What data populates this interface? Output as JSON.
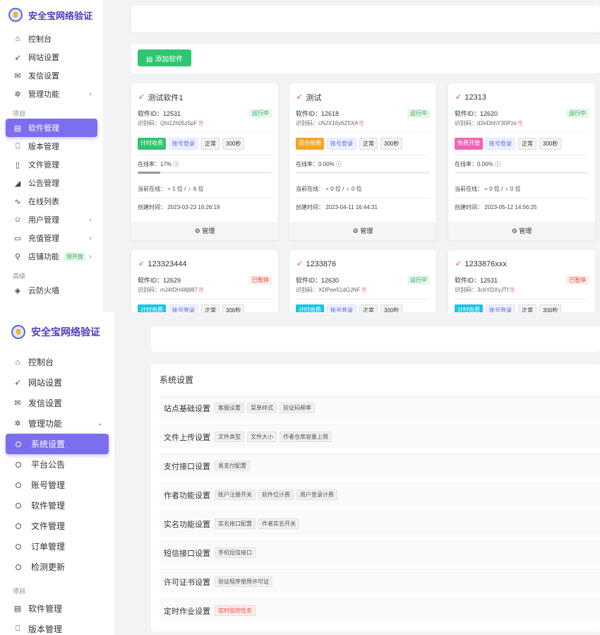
{
  "brand": {
    "title": "安全宝网络验证"
  },
  "top_sidebar": {
    "items": [
      {
        "label": "控制台",
        "icon": "home-icon"
      },
      {
        "label": "网站设置",
        "icon": "rocket-icon"
      },
      {
        "label": "发信设置",
        "icon": "mail-icon"
      },
      {
        "label": "管理功能",
        "icon": "cog-icon",
        "chevron": "›"
      }
    ],
    "section_project": "项目",
    "project_items": [
      {
        "label": "软件管理",
        "icon": "grid-icon",
        "active": true
      },
      {
        "label": "版本管理",
        "icon": "bookmark-icon"
      },
      {
        "label": "文件管理",
        "icon": "file-icon"
      },
      {
        "label": "公告管理",
        "icon": "megaphone-icon"
      },
      {
        "label": "在线列表",
        "icon": "pulse-icon"
      },
      {
        "label": "用户管理",
        "icon": "user-icon",
        "chevron": "›"
      },
      {
        "label": "充值管理",
        "icon": "card-icon",
        "chevron": "›"
      },
      {
        "label": "店铺功能",
        "icon": "pin-icon",
        "badge": "预开放",
        "chevron": "›"
      }
    ],
    "section_advanced": "高级",
    "advanced_items": [
      {
        "label": "云防火墙",
        "icon": "shield-icon"
      }
    ]
  },
  "toolbar": {
    "add_label": "添加软件"
  },
  "cards": [
    {
      "name": "测试软件1",
      "id_label": "软件ID：",
      "id": "12531",
      "code_label": "识别码：",
      "code": "Qhi12h05z5pF",
      "status": "运行中",
      "status_kind": "run",
      "mode": "计时收费",
      "mode_color": "#2ec66e",
      "login": "账号登录",
      "state": "正常",
      "interval": "300秒",
      "online_rate_label": "在线率：",
      "online_rate": "17%",
      "online_rate_value": 0.17,
      "current_online": "当前在线： ⌁ 1 位 / ♁ 6 位",
      "created": "创建时间：  2023-03-23 16:26:19",
      "footer": "⚙ 管理"
    },
    {
      "name": "测试",
      "id_label": "软件ID：",
      "id": "12618",
      "code_label": "识别码：",
      "code": "cNJX16y6Z5XA",
      "status": "运行中",
      "status_kind": "run",
      "mode": "混合收费",
      "mode_color": "#f5a623",
      "login": "账号登录",
      "state": "正常",
      "interval": "300秒",
      "online_rate_label": "在线率：",
      "online_rate": "0.00%",
      "online_rate_value": 0,
      "current_online": "当前在线： ⌁ 0 位 / ♁ 0 位",
      "created": "创建时间：  2023-04-11 16:44:31",
      "footer": "⚙ 管理"
    },
    {
      "name": "12313",
      "id_label": "软件ID：",
      "id": "12620",
      "code_label": "识别码：",
      "code": "d2eDhhY30Pze",
      "status": "运行中",
      "status_kind": "run",
      "mode": "免费开放",
      "mode_color": "#f065b6",
      "login": "账号登录",
      "state": "正常",
      "interval": "300秒",
      "online_rate_label": "在线率：",
      "online_rate": "0.00%",
      "online_rate_value": 0,
      "current_online": "当前在线： ⌁ 0 位 / ♁ 0 位",
      "created": "创建时间：  2023-05-12 14:56:25",
      "footer": "⚙ 管理"
    },
    {
      "name": "123323444",
      "id_label": "软件ID：",
      "id": "12629",
      "code_label": "识别码：",
      "code": "mJ4tDH48j887",
      "status": "已暂停",
      "status_kind": "pause",
      "mode": "计时收费",
      "mode_color": "#19c5e0",
      "login": "账号登录",
      "state": "正常",
      "interval": "300秒"
    },
    {
      "name": "1233876",
      "id_label": "软件ID：",
      "id": "12630",
      "code_label": "识别码：",
      "code": "XDPee51dGJNF",
      "status": "运行中",
      "status_kind": "run",
      "mode": "计时收费",
      "mode_color": "#19c5e0",
      "login": "账号登录",
      "state": "正常",
      "interval": "300秒"
    },
    {
      "name": "1233876xxx",
      "id_label": "软件ID：",
      "id": "12631",
      "code_label": "识别码：",
      "code": "3cbYDXyJTf",
      "status": "已暂停",
      "status_kind": "pause",
      "mode": "计时收费",
      "mode_color": "#19c5e0",
      "login": "账号登录",
      "state": "正常",
      "interval": "300秒"
    }
  ],
  "bottom_sidebar": {
    "items": [
      {
        "label": "控制台",
        "icon": "home-icon"
      },
      {
        "label": "网站设置",
        "icon": "rocket-icon"
      },
      {
        "label": "发信设置",
        "icon": "mail-icon"
      },
      {
        "label": "管理功能",
        "icon": "cog-icon",
        "chevron": "⌄"
      }
    ],
    "sub_items": [
      {
        "label": "系统设置",
        "active": true
      },
      {
        "label": "平台公告"
      },
      {
        "label": "账号管理"
      },
      {
        "label": "软件管理"
      },
      {
        "label": "文件管理"
      },
      {
        "label": "订单管理"
      },
      {
        "label": "检测更新"
      }
    ],
    "section_project": "项目",
    "project_items": [
      {
        "label": "软件管理",
        "icon": "grid-icon"
      },
      {
        "label": "版本管理",
        "icon": "bookmark-icon"
      }
    ]
  },
  "settings": {
    "title": "系统设置",
    "rows": [
      {
        "name": "站点基础设置",
        "tags": [
          "客服设置",
          "菜单样式",
          "验证码频率"
        ]
      },
      {
        "name": "文件上传设置",
        "tags": [
          "文件类型",
          "文件大小",
          "作者仓库容量上限"
        ]
      },
      {
        "name": "支付接口设置",
        "tags": [
          "易支付配置"
        ]
      },
      {
        "name": "作者功能设置",
        "tags": [
          "账户注册开关",
          "软件位计费",
          "用户登录计费"
        ]
      },
      {
        "name": "实名功能设置",
        "tags": [
          "实名接口配置",
          "作者实名开关"
        ]
      },
      {
        "name": "短信接口设置",
        "tags": [
          "手机短信接口"
        ]
      },
      {
        "name": "许可证书设置",
        "tags": [
          "验证程序使用许可证"
        ]
      },
      {
        "name": "定时作业设置",
        "tags": [
          "定时监控任务"
        ],
        "red": true
      }
    ]
  }
}
